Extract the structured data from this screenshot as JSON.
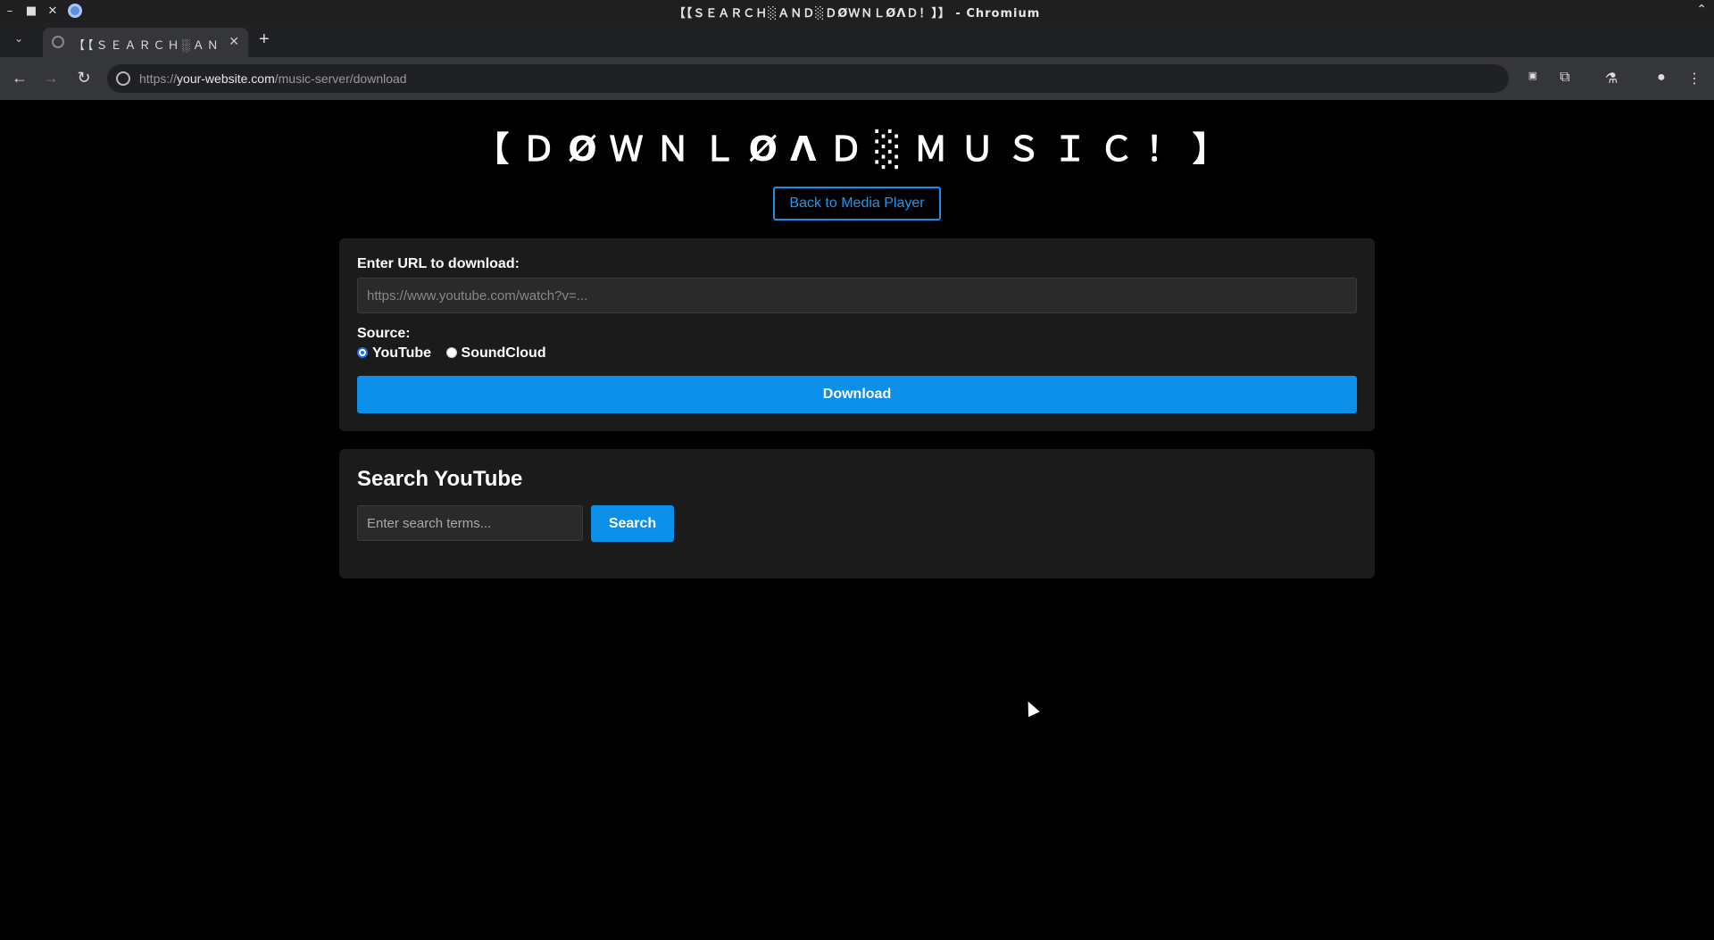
{
  "window": {
    "title": "【【ＳＥＡＲＣＨ░ＡＮＤ░ＤØＷＮＬØΛＤ！】】 - Chromium"
  },
  "tabs": [
    {
      "label": "【【ＳＥＡＲＣＨ░ＡＮＤ░ＤØＷＮＬØΛＤ！】】",
      "active": true
    }
  ],
  "address_bar": {
    "scheme": "https://",
    "host": "your-website.com",
    "path": "/music-server/download"
  },
  "page": {
    "title": "【ＤØＷＮＬØΛＤ░ＭＵＳＩＣ！】",
    "back_button": "Back to Media Player",
    "download_card": {
      "url_label": "Enter URL to download:",
      "url_placeholder": "https://www.youtube.com/watch?v=...",
      "source_label": "Source:",
      "sources": [
        {
          "label": "YouTube",
          "selected": true
        },
        {
          "label": "SoundCloud",
          "selected": false
        }
      ],
      "download_button": "Download"
    },
    "search_card": {
      "title": "Search YouTube",
      "search_placeholder": "Enter search terms...",
      "search_button": "Search"
    }
  },
  "colors": {
    "accent": "#0b8fe8",
    "background": "#000000",
    "card": "#1b1b1b"
  },
  "icons": [
    "minimize-icon",
    "maximize-icon",
    "close-icon",
    "chromium-logo-icon",
    "tab-list-icon",
    "globe-icon",
    "new-tab-icon",
    "back-icon",
    "forward-icon",
    "reload-icon",
    "site-info-icon",
    "extensions-icon",
    "labs-icon",
    "profile-icon",
    "menu-icon",
    "cursor-icon"
  ]
}
